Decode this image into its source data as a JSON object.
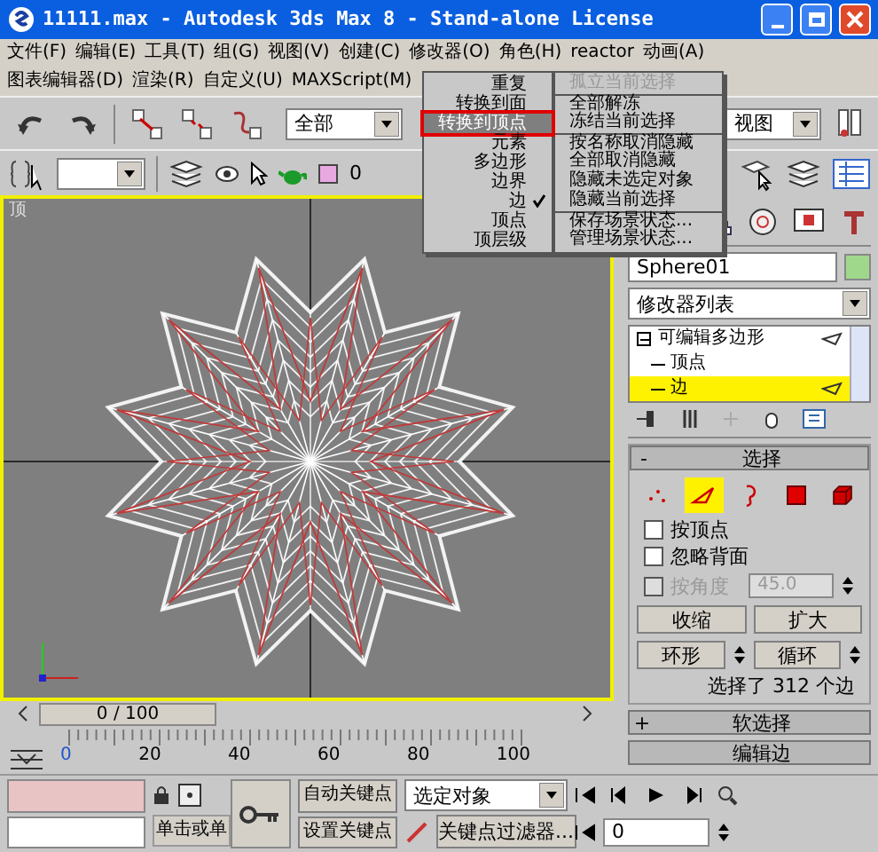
{
  "window": {
    "title": "11111.max - Autodesk 3ds Max 8  - Stand-alone License"
  },
  "menu_rows": [
    {
      "items": [
        "文件(F)",
        "编辑(E)",
        "工具(T)",
        "组(G)",
        "视图(V)",
        "创建(C)",
        "修改器(O)",
        "角色(H)",
        "reactor",
        "动画(A)"
      ]
    },
    {
      "items": [
        "图表编辑器(D)",
        "渲染(R)",
        "自定义(U)",
        "MAXScript(M)"
      ]
    }
  ],
  "main_toolbar": {
    "selection_filter": "全部",
    "reference_coordinate": "视图"
  },
  "layer_toolbar": {
    "layer": "0"
  },
  "viewport": {
    "label": "顶"
  },
  "quad_menu": {
    "left": [
      {
        "label": "重复",
        "selected": false,
        "checked": false
      },
      {
        "label": "转换到面",
        "selected": false,
        "checked": false
      },
      {
        "label": "转换到顶点",
        "selected": true,
        "checked": false
      },
      {
        "label": "元素",
        "selected": false,
        "checked": false
      },
      {
        "label": "多边形",
        "selected": false,
        "checked": false
      },
      {
        "label": "边界",
        "selected": false,
        "checked": false
      },
      {
        "label": "边",
        "selected": false,
        "checked": true
      },
      {
        "label": "顶点",
        "selected": false,
        "checked": false
      },
      {
        "label": "顶层级",
        "selected": false,
        "checked": false
      }
    ],
    "right": [
      {
        "label": "孤立当前选择",
        "disabled": true,
        "separator_before": false
      },
      {
        "label": "全部解冻",
        "disabled": false,
        "separator_before": true
      },
      {
        "label": "冻结当前选择",
        "disabled": false,
        "separator_before": false
      },
      {
        "label": "按名称取消隐藏",
        "disabled": false,
        "separator_before": true
      },
      {
        "label": "全部取消隐藏",
        "disabled": false,
        "separator_before": false
      },
      {
        "label": "隐藏未选定对象",
        "disabled": false,
        "separator_before": false
      },
      {
        "label": "隐藏当前选择",
        "disabled": false,
        "separator_before": false
      },
      {
        "label": "保存场景状态...",
        "disabled": false,
        "separator_before": true
      },
      {
        "label": "管理场景状态...",
        "disabled": false,
        "separator_before": false
      }
    ]
  },
  "command_panel": {
    "object_name": "Sphere01",
    "modifier_list": "修改器列表",
    "stack": [
      {
        "label": "可编辑多边形",
        "selected": false,
        "expanded": true,
        "children": [
          {
            "label": "顶点",
            "selected": false
          },
          {
            "label": "边",
            "selected": true
          }
        ]
      }
    ],
    "selection_rollout": {
      "toggle": "-",
      "title": "选择",
      "subobject_levels": [
        {
          "kind": "vertex",
          "selected": false
        },
        {
          "kind": "edge",
          "selected": true
        },
        {
          "kind": "border",
          "selected": false
        },
        {
          "kind": "polygon",
          "selected": false
        },
        {
          "kind": "element",
          "selected": false
        }
      ],
      "checkboxes": [
        {
          "label": "按顶点",
          "checked": false,
          "disabled": false
        },
        {
          "label": "忽略背面",
          "checked": false,
          "disabled": false
        },
        {
          "label": "按角度",
          "checked": false,
          "disabled": true
        }
      ],
      "angle_value": "45.0",
      "buttons": [
        "收缩",
        "扩大"
      ],
      "spinner_buttons": [
        "环形",
        "循环"
      ],
      "status": "选择了 312 个边"
    },
    "rollouts": [
      {
        "toggle": "+",
        "title": "软选择"
      },
      {
        "title": "编辑边"
      }
    ]
  },
  "time_slider": {
    "position": "0 / 100"
  },
  "track_bar": {
    "ticks": [
      "0",
      "20",
      "40",
      "60",
      "80",
      "100"
    ]
  },
  "status_bar": {
    "prompt": "单击或单",
    "auto_key": "自动关键点",
    "key_mode": "选定对象",
    "set_key": "设置关键点",
    "key_filters": "关键点过滤器...",
    "frame": "0"
  }
}
